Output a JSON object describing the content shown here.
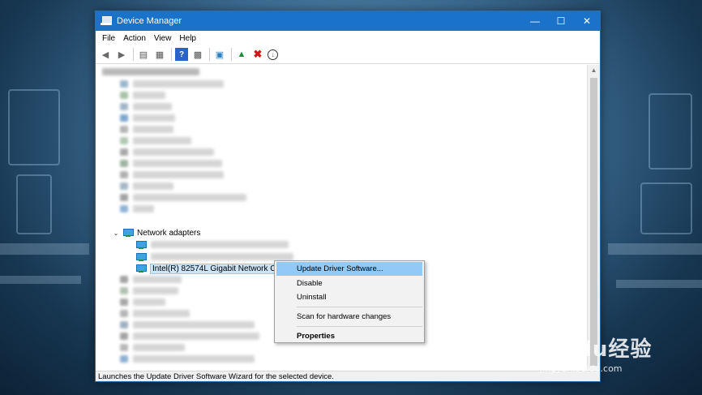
{
  "window": {
    "title": "Device Manager"
  },
  "menu": [
    "File",
    "Action",
    "View",
    "Help"
  ],
  "tree": {
    "network_adapters_label": "Network adapters",
    "selected_device": "Intel(R) 82574L Gigabit Network Connection"
  },
  "context_menu": {
    "update": "Update Driver Software...",
    "disable": "Disable",
    "uninstall": "Uninstall",
    "scan": "Scan for hardware changes",
    "properties": "Properties"
  },
  "status": "Launches the Update Driver Software Wizard for the selected device.",
  "watermark": {
    "main": "Baidu经验",
    "sub": "jingyan.baidu.com"
  },
  "icons": {
    "back": "back-arrow-icon",
    "forward": "forward-arrow-icon",
    "properties": "properties-icon",
    "help": "help-icon",
    "scan": "scan-hardware-icon",
    "uninstall": "uninstall-icon"
  }
}
